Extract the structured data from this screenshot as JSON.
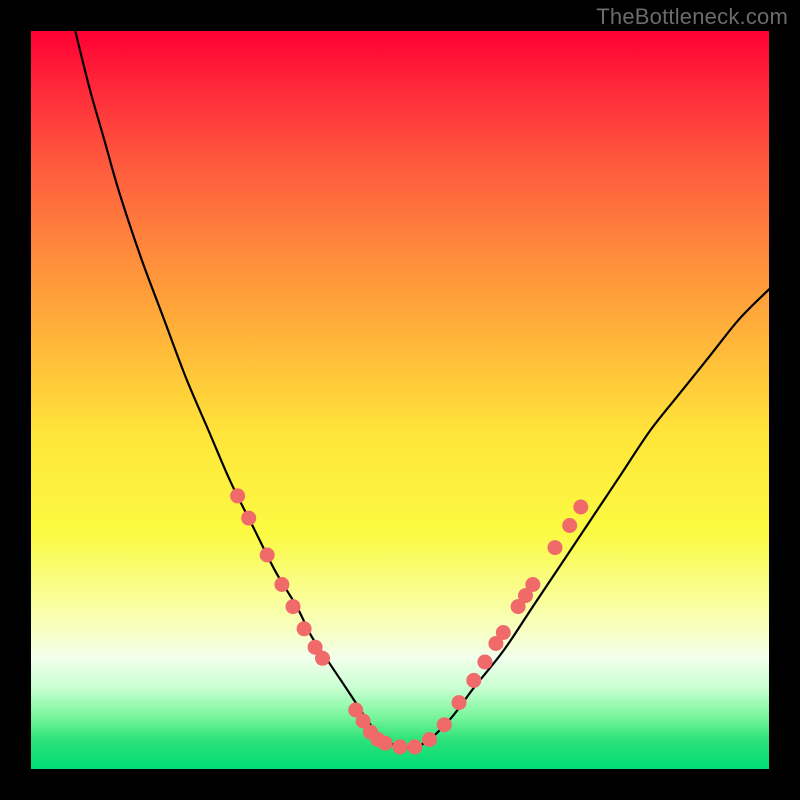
{
  "watermark": "TheBottleneck.com",
  "chart_data": {
    "type": "line",
    "title": "",
    "xlabel": "",
    "ylabel": "",
    "xlim": [
      0,
      100
    ],
    "ylim": [
      0,
      100
    ],
    "grid": false,
    "legend": false,
    "series": [
      {
        "name": "curve",
        "x": [
          6,
          8,
          10,
          12,
          15,
          18,
          21,
          24,
          27,
          30,
          33,
          36,
          38,
          40,
          42,
          44,
          46,
          48,
          50,
          52,
          54,
          57,
          60,
          64,
          68,
          72,
          76,
          80,
          84,
          88,
          92,
          96,
          100
        ],
        "values": [
          100,
          92,
          85,
          78,
          69,
          61,
          53,
          46,
          39,
          33,
          27,
          22,
          18,
          15,
          12,
          9,
          6,
          4,
          3,
          3,
          4,
          7,
          11,
          16,
          22,
          28,
          34,
          40,
          46,
          51,
          56,
          61,
          65
        ]
      }
    ],
    "markers": {
      "name": "highlight-points",
      "color": "#f06a6a",
      "points": [
        {
          "x": 28,
          "y": 37
        },
        {
          "x": 29.5,
          "y": 34
        },
        {
          "x": 32,
          "y": 29
        },
        {
          "x": 34,
          "y": 25
        },
        {
          "x": 35.5,
          "y": 22
        },
        {
          "x": 37,
          "y": 19
        },
        {
          "x": 38.5,
          "y": 16.5
        },
        {
          "x": 39.5,
          "y": 15
        },
        {
          "x": 44,
          "y": 8
        },
        {
          "x": 45,
          "y": 6.5
        },
        {
          "x": 46,
          "y": 5
        },
        {
          "x": 47,
          "y": 4
        },
        {
          "x": 48,
          "y": 3.5
        },
        {
          "x": 50,
          "y": 3
        },
        {
          "x": 52,
          "y": 3
        },
        {
          "x": 54,
          "y": 4
        },
        {
          "x": 56,
          "y": 6
        },
        {
          "x": 58,
          "y": 9
        },
        {
          "x": 60,
          "y": 12
        },
        {
          "x": 61.5,
          "y": 14.5
        },
        {
          "x": 63,
          "y": 17
        },
        {
          "x": 64,
          "y": 18.5
        },
        {
          "x": 66,
          "y": 22
        },
        {
          "x": 67,
          "y": 23.5
        },
        {
          "x": 68,
          "y": 25
        },
        {
          "x": 71,
          "y": 30
        },
        {
          "x": 73,
          "y": 33
        },
        {
          "x": 74.5,
          "y": 35.5
        }
      ]
    },
    "background_gradient": {
      "top": "#ff0033",
      "middle": "#ffe63a",
      "bottom": "#00dc76"
    }
  }
}
